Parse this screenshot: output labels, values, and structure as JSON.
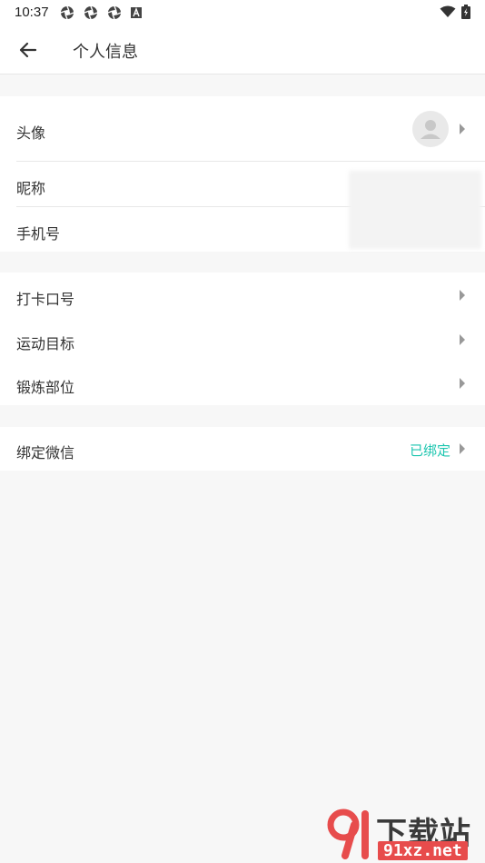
{
  "status_bar": {
    "time": "10:37",
    "notification_icons": [
      "aperture-icon",
      "aperture-icon",
      "aperture-icon",
      "a-badge-icon"
    ],
    "right_icons": [
      "wifi-icon",
      "battery-charging-icon"
    ]
  },
  "header": {
    "title": "个人信息",
    "back_icon": "arrow-left-icon"
  },
  "profile": {
    "avatar_label": "头像",
    "nickname_label": "昵称",
    "phone_label": "手机号"
  },
  "goals": {
    "checkin_label": "打卡口号",
    "target_label": "运动目标",
    "body_part_label": "锻炼部位"
  },
  "wechat": {
    "label": "绑定微信",
    "status": "已绑定",
    "status_color": "#1ec6b0"
  },
  "watermark": {
    "cn": "下载站",
    "en": "91xz.net",
    "logo": "91"
  },
  "colors": {
    "background": "#f7f7f7",
    "card": "#ffffff",
    "accent": "#1ec6b0"
  }
}
